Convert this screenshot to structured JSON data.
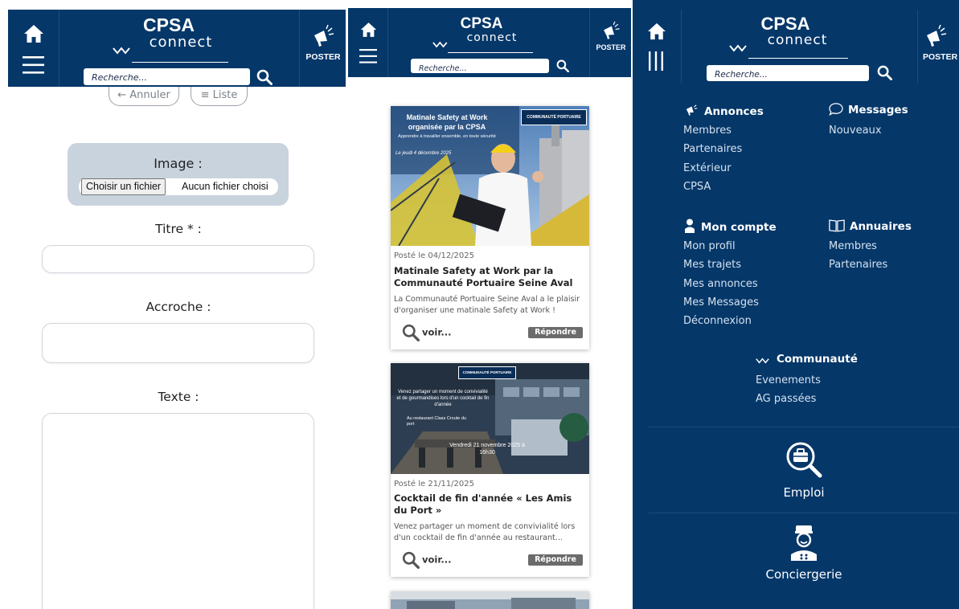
{
  "header": {
    "logo_line1": "CPSA",
    "logo_line2": "connect",
    "search_placeholder": "Recherche...",
    "poster_label": "POSTER"
  },
  "form": {
    "cancel_label": "← Annuler",
    "list_label": "≡  Liste",
    "image_label": "Image :",
    "file_button": "Choisir un fichier",
    "file_status": "Aucun fichier choisi",
    "title_label": "Titre * :",
    "hook_label": "Accroche :",
    "text_label": "Texte :"
  },
  "feed": {
    "posts": [
      {
        "image_title": "Matinale Safety at Work organisée par la CPSA",
        "image_subtitle": "Apprendre à travailler ensemble, en toute sécurité",
        "image_date": "Le jeudi 4 décembre 2025",
        "image_badge": "COMMUNAUTÉ PORTUAIRE",
        "date": "Posté le 04/12/2025",
        "title": "Matinale Safety at Work par la Communauté Portuaire Seine Aval",
        "excerpt": "La Communauté Portuaire Seine Aval a le plaisir d'organiser une matinale Safety at Work !",
        "voir": "voir...",
        "reply": "Répondre"
      },
      {
        "image_title": "Venez partager un moment de convivialité et de gourmandises lors d'un cocktail de fin d'année",
        "image_subtitle": "Au restaurant Class Croute du port",
        "image_date": "Vendredi 21 novembre 2025 à 16h30",
        "image_badge": "COMMUNAUTÉ PORTUAIRE",
        "date": "Posté le 21/11/2025",
        "title": "Cocktail de fin d'année « Les Amis du Port »",
        "excerpt": "Venez partager un moment de convivialité lors d'un cocktail de fin d'année au restaurant...",
        "voir": "voir...",
        "reply": "Répondre"
      }
    ]
  },
  "menu": {
    "annonces": {
      "title": "Annonces",
      "items": [
        "Membres",
        "Partenaires",
        "Extérieur",
        "CPSA"
      ]
    },
    "messages": {
      "title": "Messages",
      "items": [
        "Nouveaux"
      ]
    },
    "compte": {
      "title": "Mon compte",
      "items": [
        "Mon profil",
        "Mes trajets",
        "Mes annonces",
        "Mes Messages",
        "Déconnexion"
      ]
    },
    "annuaires": {
      "title": "Annuaires",
      "items": [
        "Membres",
        "Partenaires"
      ]
    },
    "communaute": {
      "title": "Communauté",
      "items": [
        "Evenements",
        "AG passées"
      ]
    },
    "emploi": "Emploi",
    "conciergerie": "Conciergerie"
  },
  "colors": {
    "brand_navy": "#053769",
    "image_panel": "#c9d3de",
    "reply_button": "#6b6b6b"
  }
}
